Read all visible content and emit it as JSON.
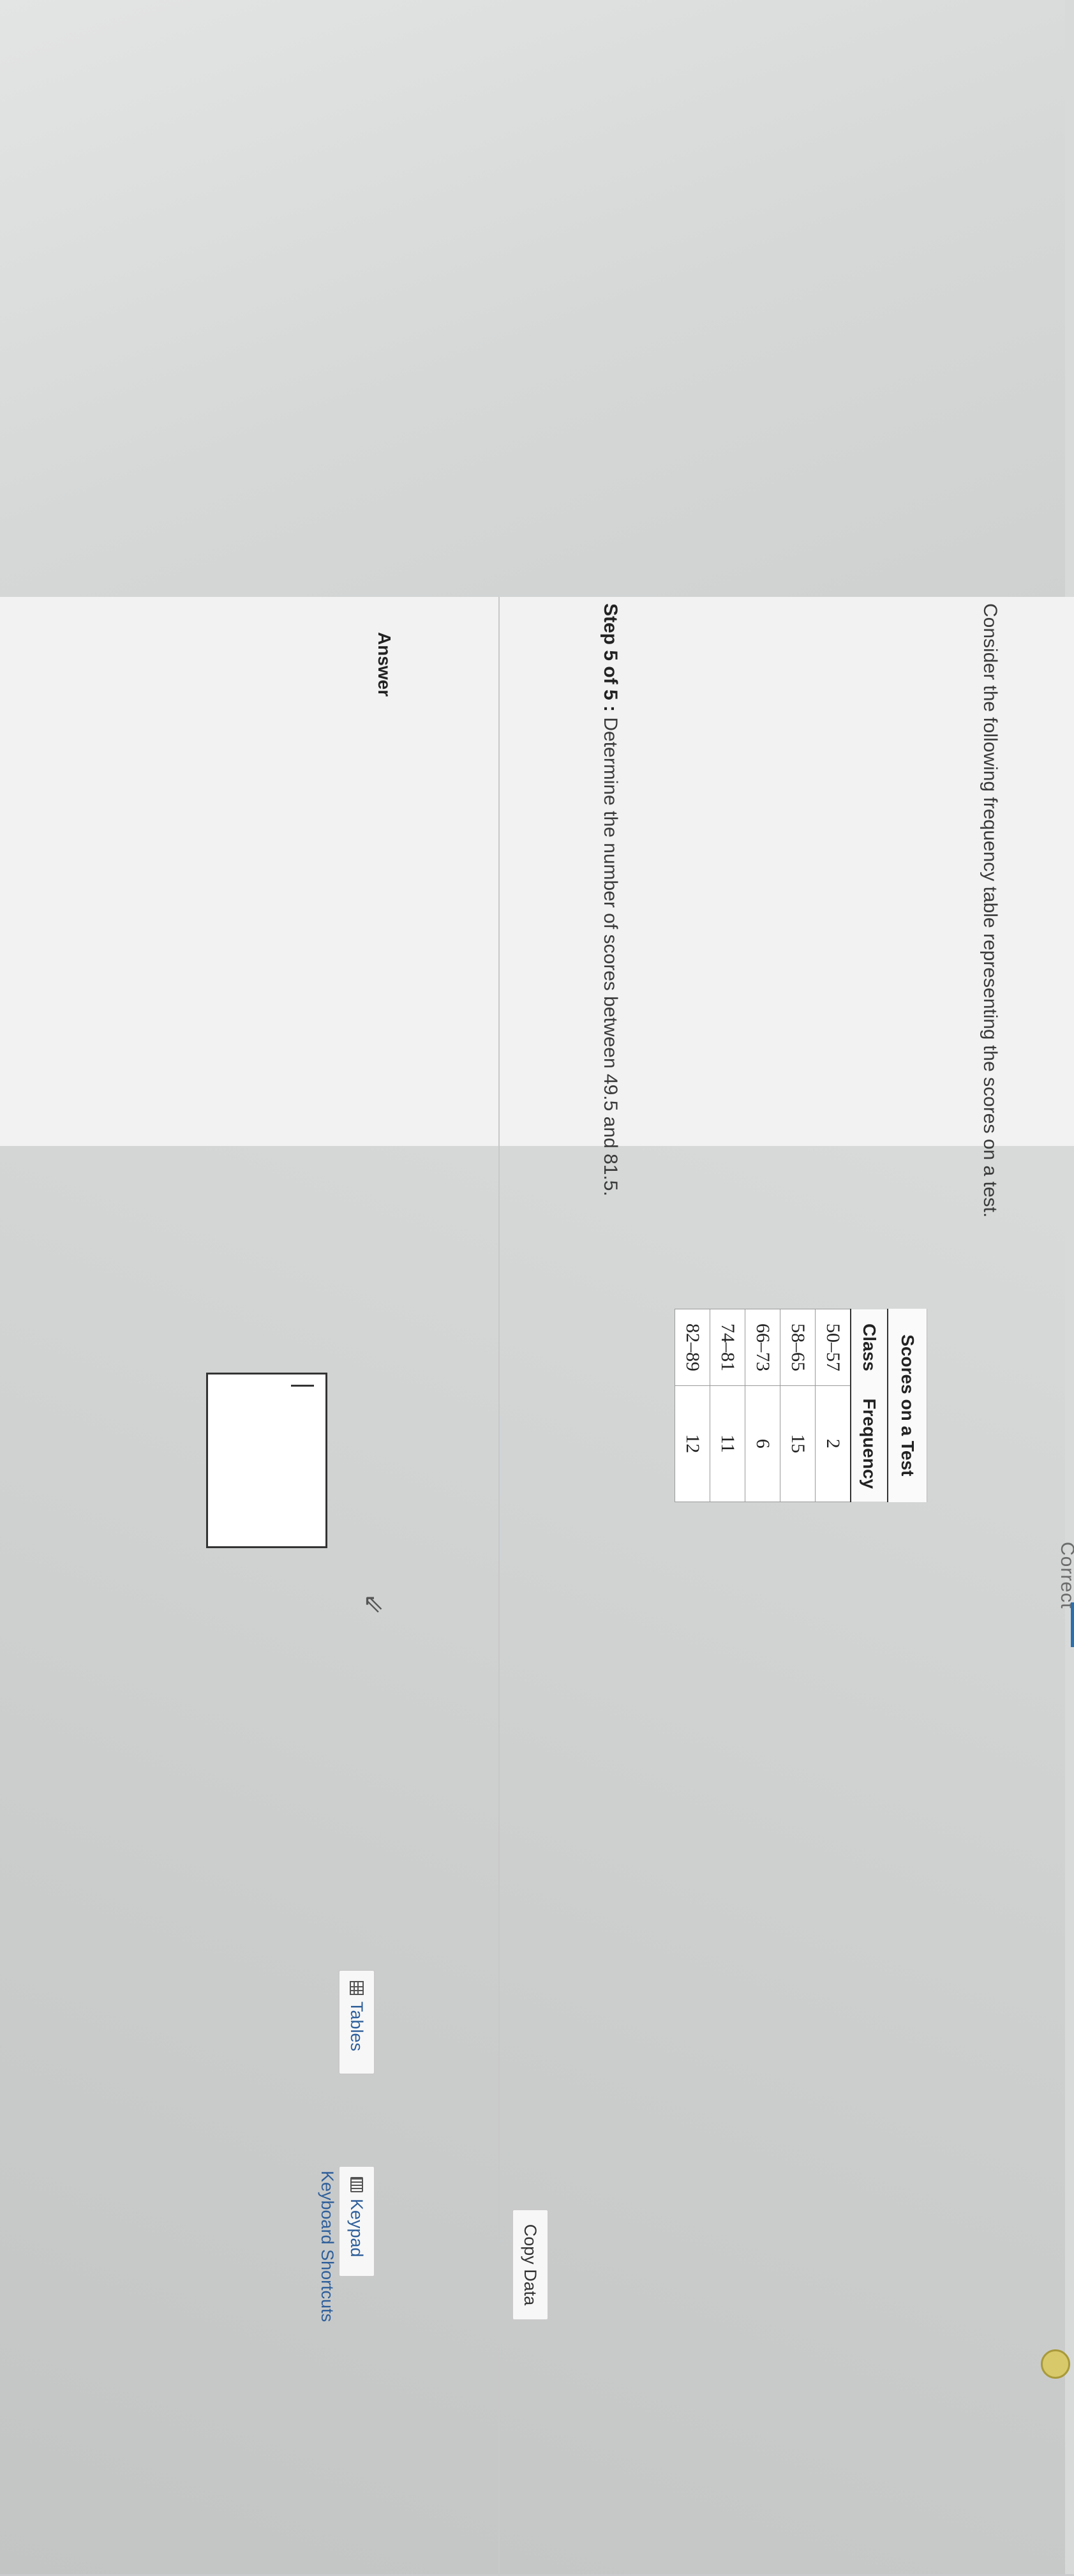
{
  "header": {
    "status_label": "Correct"
  },
  "question": {
    "text": "Consider the following frequency table representing the scores on a test."
  },
  "table": {
    "caption": "Scores on a Test",
    "headers": [
      "Class",
      "Frequency"
    ],
    "rows": [
      {
        "class": "50–57",
        "frequency": "2"
      },
      {
        "class": "58–65",
        "frequency": "15"
      },
      {
        "class": "66–73",
        "frequency": "6"
      },
      {
        "class": "74–81",
        "frequency": "11"
      },
      {
        "class": "82–89",
        "frequency": "12"
      }
    ]
  },
  "step": {
    "label": "Step 5 of 5 :",
    "text": "Determine the number of scores between 49.5 and 81.5."
  },
  "answer": {
    "label": "Answer",
    "value": ""
  },
  "buttons": {
    "copy_data": "Copy Data",
    "tables": "Tables",
    "keypad": "Keypad",
    "keyboard_shortcuts": "Keyboard Shortcuts"
  },
  "icons": {
    "tables": "table-grid-icon",
    "keypad": "keypad-icon",
    "cursor": "mouse-pointer-icon"
  },
  "colors": {
    "link": "#2f5f9a",
    "accent": "#2a6fb0"
  }
}
